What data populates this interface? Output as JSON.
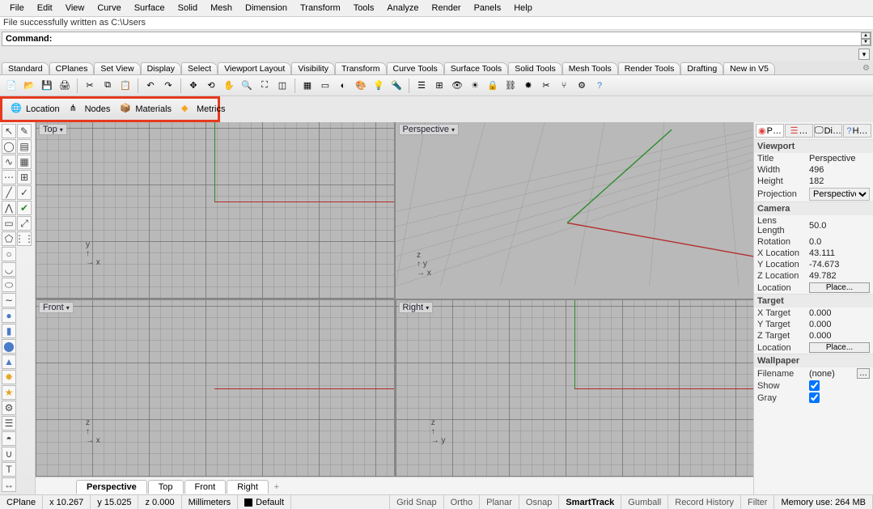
{
  "menu": [
    "File",
    "Edit",
    "View",
    "Curve",
    "Surface",
    "Solid",
    "Mesh",
    "Dimension",
    "Transform",
    "Tools",
    "Analyze",
    "Render",
    "Panels",
    "Help"
  ],
  "message": "File successfully written as C:\\Users",
  "commandLabel": "Command:",
  "commandValue": "",
  "toolbarTabs": [
    "Standard",
    "CPlanes",
    "Set View",
    "Display",
    "Select",
    "Viewport Layout",
    "Visibility",
    "Transform",
    "Curve Tools",
    "Surface Tools",
    "Solid Tools",
    "Mesh Tools",
    "Render Tools",
    "Drafting",
    "New in V5"
  ],
  "uva": {
    "location": "Location",
    "nodes": "Nodes",
    "materials": "Materials",
    "metrics": "Metrics"
  },
  "viewports": {
    "tl": "Top",
    "tr": "Perspective",
    "bl": "Front",
    "br": "Right"
  },
  "vpTabs": [
    "Perspective",
    "Top",
    "Front",
    "Right"
  ],
  "rightTabs": [
    "P…",
    "…",
    "Di…",
    "H…"
  ],
  "props": {
    "viewport": {
      "section": "Viewport",
      "title_k": "Title",
      "title_v": "Perspective",
      "width_k": "Width",
      "width_v": "496",
      "height_k": "Height",
      "height_v": "182",
      "proj_k": "Projection",
      "proj_v": "Perspective"
    },
    "camera": {
      "section": "Camera",
      "lens_k": "Lens Length",
      "lens_v": "50.0",
      "rot_k": "Rotation",
      "rot_v": "0.0",
      "x_k": "X Location",
      "x_v": "43.111",
      "y_k": "Y Location",
      "y_v": "-74.673",
      "z_k": "Z Location",
      "z_v": "49.782",
      "loc_k": "Location",
      "place": "Place..."
    },
    "target": {
      "section": "Target",
      "x_k": "X Target",
      "x_v": "0.000",
      "y_k": "Y Target",
      "y_v": "0.000",
      "z_k": "Z Target",
      "z_v": "0.000",
      "loc_k": "Location",
      "place": "Place..."
    },
    "wallpaper": {
      "section": "Wallpaper",
      "fn_k": "Filename",
      "fn_v": "(none)",
      "show_k": "Show",
      "gray_k": "Gray"
    }
  },
  "status": {
    "cplane": "CPlane",
    "x": "x 10.267",
    "y": "y 15.025",
    "z": "z 0.000",
    "units": "Millimeters",
    "layer": "Default",
    "gridsnap": "Grid Snap",
    "ortho": "Ortho",
    "planar": "Planar",
    "osnap": "Osnap",
    "smarttrack": "SmartTrack",
    "gumball": "Gumball",
    "record": "Record History",
    "filter": "Filter",
    "mem": "Memory use: 264 MB"
  }
}
